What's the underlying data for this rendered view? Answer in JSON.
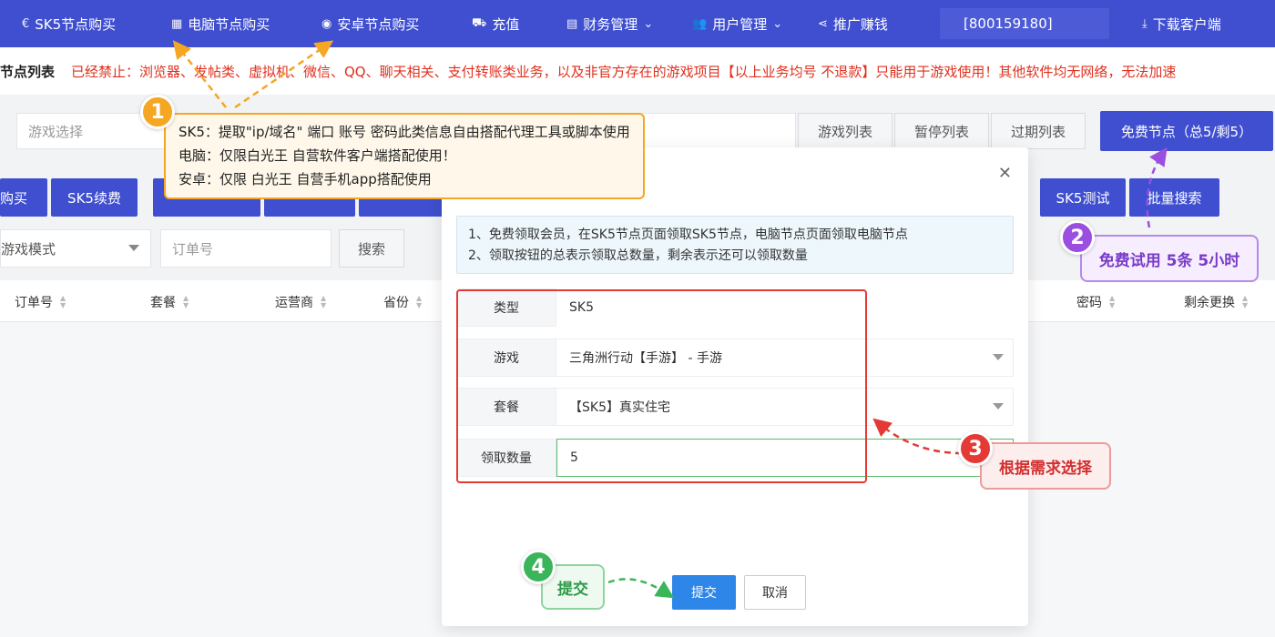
{
  "nav": {
    "items": [
      {
        "label": "SK5节点购买",
        "icon": "euro-icon"
      },
      {
        "label": "电脑节点购买",
        "icon": "windows-icon"
      },
      {
        "label": "安卓节点购买",
        "icon": "android-icon"
      },
      {
        "label": "充值",
        "icon": "cart-icon"
      },
      {
        "label": "财务管理",
        "icon": "finance-icon"
      },
      {
        "label": "用户管理",
        "icon": "users-icon"
      },
      {
        "label": "推广赚钱",
        "icon": "share-icon"
      }
    ],
    "account": "[800159180]",
    "download": "下载客户端"
  },
  "notice": {
    "title": "节点列表",
    "text": "已经禁止：浏览器、发帖类、虚拟机、微信、QQ、聊天相关、支付转账类业务，以及非官方存在的游戏项目【以上业务均号 不退款】只能用于游戏使用！其他软件均无网络，无法加速"
  },
  "filters": {
    "game_placeholder": "游戏选择",
    "tabs": [
      "游戏列表",
      "暂停列表",
      "过期列表"
    ],
    "free_button": "免费节点（总5/剩5）",
    "buy_button": "购买",
    "renew_button": "SK5续费",
    "sk5_test": "SK5测试",
    "batch_search": "批量搜索",
    "mode_select": "游戏模式",
    "order_placeholder": "订单号",
    "search_button": "搜索"
  },
  "table": {
    "columns": [
      "订单号",
      "套餐",
      "运营商",
      "省份",
      "密码",
      "剩余更换"
    ]
  },
  "modal": {
    "info": [
      "1、免费领取会员，在SK5节点页面领取SK5节点，电脑节点页面领取电脑节点",
      "2、领取按钮的总表示领取总数量，剩余表示还可以领取数量"
    ],
    "fields": [
      {
        "label": "类型",
        "value": "SK5"
      },
      {
        "label": "游戏",
        "value": "三角洲行动【手游】 - 手游"
      },
      {
        "label": "套餐",
        "value": "【SK5】真实住宅"
      },
      {
        "label": "领取数量",
        "value": "5"
      }
    ],
    "submit": "提交",
    "cancel": "取消"
  },
  "annotations": {
    "one": {
      "number": "1",
      "lines": [
        "SK5：提取\"ip/域名\" 端口 账号 密码此类信息自由搭配代理工具或脚本使用",
        "电脑：仅限白光王 自营软件客户端搭配使用！",
        "安卓：仅限 白光王 自营手机app搭配使用"
      ]
    },
    "two": {
      "number": "2",
      "text": "免费试用 5条 5小时"
    },
    "three": {
      "number": "3",
      "text": "根据需求选择"
    },
    "four": {
      "number": "4",
      "text": "提交"
    }
  },
  "colors": {
    "nav_bg": "#3f4fcf",
    "notice_red": "#e0301e",
    "orange": "#f5a623",
    "purple": "#9b4fe0",
    "red": "#e53935",
    "green": "#3bb55a",
    "submit_blue": "#2e86e8"
  }
}
